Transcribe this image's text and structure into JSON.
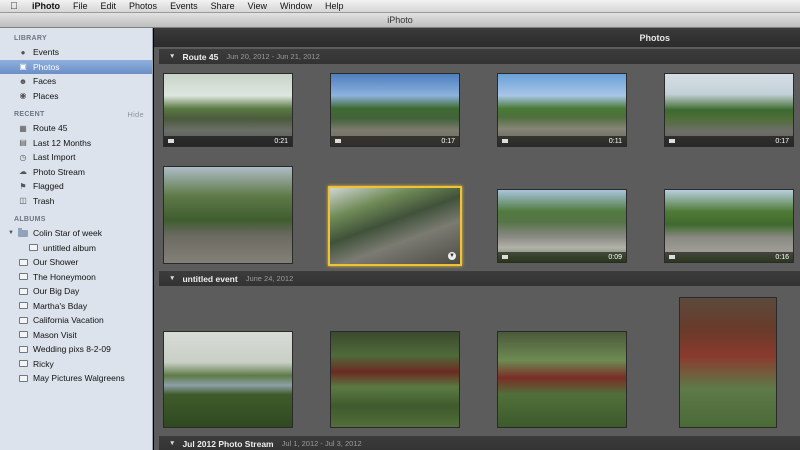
{
  "menubar": {
    "items": [
      "iPhoto",
      "File",
      "Edit",
      "Photos",
      "Events",
      "Share",
      "View",
      "Window",
      "Help"
    ]
  },
  "window": {
    "title": "iPhoto"
  },
  "sidebar": {
    "library_header": "LIBRARY",
    "library": [
      {
        "label": "Events",
        "icon": "events-icon"
      },
      {
        "label": "Photos",
        "icon": "photos-icon",
        "selected": true
      },
      {
        "label": "Faces",
        "icon": "faces-icon"
      },
      {
        "label": "Places",
        "icon": "places-icon"
      }
    ],
    "recent_header": "RECENT",
    "recent_hide": "Hide",
    "recent": [
      {
        "label": "Route 45",
        "icon": "event-icon"
      },
      {
        "label": "Last 12 Months",
        "icon": "calendar-icon"
      },
      {
        "label": "Last Import",
        "icon": "import-icon"
      },
      {
        "label": "Photo Stream",
        "icon": "photo-stream-icon"
      },
      {
        "label": "Flagged",
        "icon": "flag-icon"
      },
      {
        "label": "Trash",
        "icon": "trash-icon"
      }
    ],
    "albums_header": "ALBUMS",
    "albums": [
      {
        "label": "Colin Star of week",
        "icon": "folder-icon"
      },
      {
        "label": "untitled album",
        "icon": "album-icon",
        "indent": true
      },
      {
        "label": "Our Shower",
        "icon": "album-icon"
      },
      {
        "label": "The Honeymoon",
        "icon": "album-icon"
      },
      {
        "label": "Our Big Day",
        "icon": "album-icon"
      },
      {
        "label": "Martha's Bday",
        "icon": "album-icon"
      },
      {
        "label": "California Vacation",
        "icon": "album-icon"
      },
      {
        "label": "Mason Visit",
        "icon": "album-icon"
      },
      {
        "label": "Wedding pixs 8-2-09",
        "icon": "album-icon"
      },
      {
        "label": "Ricky",
        "icon": "album-icon"
      },
      {
        "label": "May Pictures Walgreens",
        "icon": "album-icon"
      }
    ]
  },
  "main": {
    "title": "Photos",
    "events": [
      {
        "name": "Route 45",
        "dates": "Jun 20, 2012 - Jun 21, 2012",
        "photos": [
          {
            "duration": "0:21",
            "video": true,
            "palette": "ph-road1"
          },
          {
            "duration": "0:17",
            "video": true,
            "palette": "ph-road2"
          },
          {
            "duration": "0:11",
            "video": true,
            "palette": "ph-road3"
          },
          {
            "duration": "0:17",
            "video": true,
            "palette": "ph-road4"
          },
          {
            "duration": "",
            "video": false,
            "palette": "ph-house"
          },
          {
            "duration": "",
            "video": false,
            "palette": "ph-path",
            "selected": true
          },
          {
            "duration": "0:09",
            "video": true,
            "palette": "ph-street"
          },
          {
            "duration": "0:16",
            "video": true,
            "palette": "ph-street2"
          }
        ]
      },
      {
        "name": "untitled event",
        "dates": "June 24, 2012",
        "photos": [
          {
            "duration": "",
            "video": false,
            "palette": "ph-pond"
          },
          {
            "duration": "",
            "video": false,
            "palette": "ph-forest"
          },
          {
            "duration": "",
            "video": false,
            "palette": "ph-forest2"
          },
          {
            "duration": "",
            "video": false,
            "palette": "ph-forest3"
          }
        ]
      },
      {
        "name": "Jul 2012 Photo Stream",
        "dates": "Jul 1, 2012 - Jul 3, 2012",
        "photos": []
      }
    ]
  }
}
